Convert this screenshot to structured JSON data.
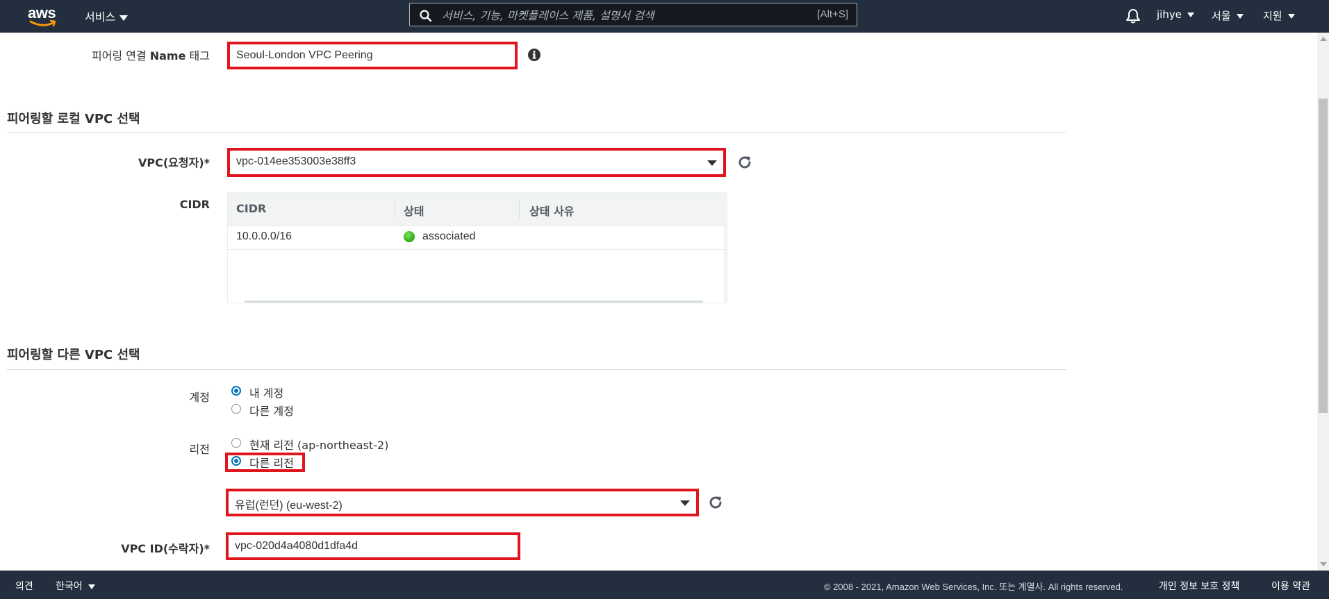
{
  "nav": {
    "logo_text": "aws",
    "services_label": "서비스",
    "search_placeholder": "서비스, 기능, 마켓플레이스 제품, 설명서 검색",
    "search_shortcut": "[Alt+S]",
    "user": "jihye",
    "region": "서울",
    "support": "지원"
  },
  "form": {
    "name_tag": {
      "label_prefix": "피어링 연결",
      "label_bold": "Name",
      "label_suffix": "태그",
      "value": "Seoul-London VPC Peering"
    },
    "local_section_title": "피어링할 로컬 VPC 선택",
    "requester": {
      "label": "VPC(요청자)*",
      "value": "vpc-014ee353003e38ff3"
    },
    "cidr": {
      "label": "CIDR",
      "columns": [
        "CIDR",
        "상태",
        "상태 사유"
      ],
      "rows": [
        {
          "cidr": "10.0.0.0/16",
          "status": "associated",
          "reason": ""
        }
      ]
    },
    "other_section_title": "피어링할 다른 VPC 선택",
    "account": {
      "label": "계정",
      "options": [
        "내 계정",
        "다른 계정"
      ],
      "selected": "내 계정"
    },
    "region": {
      "label": "리전",
      "options": [
        "현재 리전 (ap-northeast-2)",
        "다른 리전"
      ],
      "selected": "다른 리전",
      "dropdown_value": "유럽(런던) (eu-west-2)"
    },
    "accepter": {
      "label": "VPC ID(수락자)*",
      "value": "vpc-020d4a4080d1dfa4d"
    }
  },
  "footer": {
    "feedback": "의견",
    "language": "한국어",
    "copyright": "© 2008 - 2021, Amazon Web Services, Inc. 또는 계열사. All rights reserved.",
    "privacy": "개인 정보 보호 정책",
    "terms": "이용 약관"
  },
  "colors": {
    "nav_bg": "#232f3e",
    "highlight": "#e0151d",
    "radio_accent": "#0073bb",
    "status_green": "#3cb31d"
  }
}
